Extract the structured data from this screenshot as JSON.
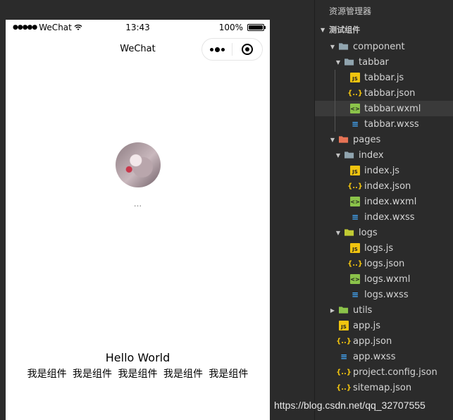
{
  "statusbar": {
    "carrier": "WeChat",
    "time": "13:43",
    "battery": "100%",
    "battery_level": 1.0
  },
  "navbar": {
    "title": "WeChat"
  },
  "page": {
    "nickname": "...",
    "hello": "Hello World",
    "components": [
      "我是组件",
      "我是组件",
      "我是组件",
      "我是组件",
      "我是组件"
    ]
  },
  "explorer": {
    "header": "资源管理器",
    "section": "测试组件",
    "tree": [
      {
        "label": "component",
        "type": "folder",
        "depth": 1,
        "expanded": true
      },
      {
        "label": "tabbar",
        "type": "folder",
        "depth": 2,
        "expanded": true
      },
      {
        "label": "tabbar.js",
        "type": "js",
        "depth": 3
      },
      {
        "label": "tabbar.json",
        "type": "json",
        "depth": 3
      },
      {
        "label": "tabbar.wxml",
        "type": "wxml",
        "depth": 3,
        "selected": true
      },
      {
        "label": "tabbar.wxss",
        "type": "wxss",
        "depth": 3
      },
      {
        "label": "pages",
        "type": "folder-pages",
        "depth": 1,
        "expanded": true
      },
      {
        "label": "index",
        "type": "folder",
        "depth": 2,
        "expanded": true
      },
      {
        "label": "index.js",
        "type": "js",
        "depth": 3
      },
      {
        "label": "index.json",
        "type": "json",
        "depth": 3
      },
      {
        "label": "index.wxml",
        "type": "wxml",
        "depth": 3
      },
      {
        "label": "index.wxss",
        "type": "wxss",
        "depth": 3
      },
      {
        "label": "logs",
        "type": "folder-logs",
        "depth": 2,
        "expanded": true
      },
      {
        "label": "logs.js",
        "type": "js",
        "depth": 3
      },
      {
        "label": "logs.json",
        "type": "json",
        "depth": 3
      },
      {
        "label": "logs.wxml",
        "type": "wxml",
        "depth": 3
      },
      {
        "label": "logs.wxss",
        "type": "wxss",
        "depth": 3
      },
      {
        "label": "utils",
        "type": "folder-utils",
        "depth": 1,
        "expanded": false
      },
      {
        "label": "app.js",
        "type": "js",
        "depth": 1
      },
      {
        "label": "app.json",
        "type": "json",
        "depth": 1
      },
      {
        "label": "app.wxss",
        "type": "wxss",
        "depth": 1
      },
      {
        "label": "project.config.json",
        "type": "json",
        "depth": 1
      },
      {
        "label": "sitemap.json",
        "type": "json",
        "depth": 1
      }
    ]
  },
  "watermark": "https://blog.csdn.net/qq_32707555",
  "colors": {
    "folder": "#90a4ae",
    "folder_pages": "#e57355",
    "folder_logs": "#c0ca33",
    "folder_utils": "#8bc34a",
    "js": "#f1c40f",
    "json": "#f1c40f",
    "wxml": "#8bc34a",
    "wxss": "#42a5f5"
  }
}
